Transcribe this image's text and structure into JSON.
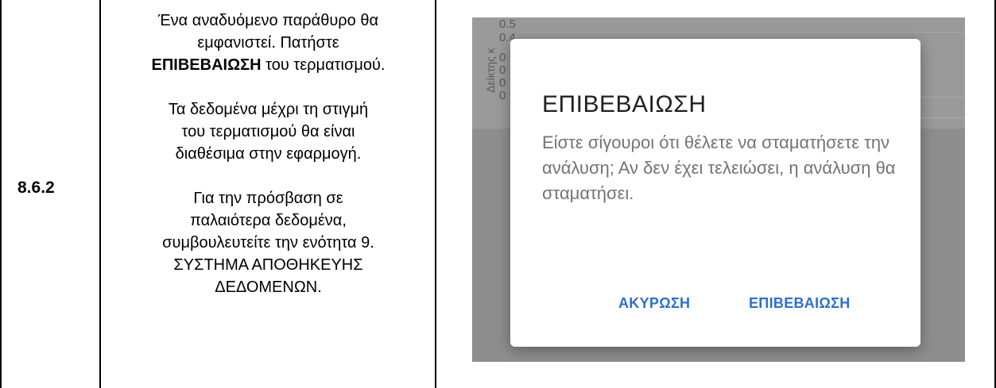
{
  "step_number": "8.6.2",
  "description": {
    "para1_part1": "Ένα αναδυόμενο παράθυρο θα",
    "para1_part2": "εμφανιστεί. Πατήστε",
    "para1_bold": "ΕΠΙΒΕΒΑΙΩΣΗ",
    "para1_part3": " του τερματισμού.",
    "para2_line1": "Τα δεδομένα μέχρι τη στιγμή",
    "para2_line2": "του τερματισμού θα είναι",
    "para2_line3": "διαθέσιμα στην εφαρμογή.",
    "para3_line1": "Για την πρόσβαση σε",
    "para3_line2": "παλαιότερα δεδομένα,",
    "para3_line3": "συμβουλευτείτε την ενότητα 9.",
    "para3_line4": "ΣΥΣΤΗΜΑ ΑΠΟΘΗΚΕΥΗΣ",
    "para3_line5": "ΔΕΔΟΜΕΝΩΝ."
  },
  "background_chart": {
    "ticks": [
      "0.5",
      "0.4",
      "0",
      "0",
      "0",
      "0"
    ],
    "ylabel": "Δείκτης κ"
  },
  "dialog": {
    "title": "ΕΠΙΒΕΒΑΙΩΣΗ",
    "message": "Είστε σίγουροι ότι θέλετε να σταματήσετε την ανάλυση; Αν δεν έχει τελειώσει, η ανάλυση θα σταματήσει.",
    "cancel_label": "ΑΚΥΡΩΣΗ",
    "confirm_label": "ΕΠΙΒΕΒΑΙΩΣΗ"
  },
  "colors": {
    "accent": "#2b6fd6",
    "overlay": "#8e8e8e",
    "message_text": "#737373"
  }
}
